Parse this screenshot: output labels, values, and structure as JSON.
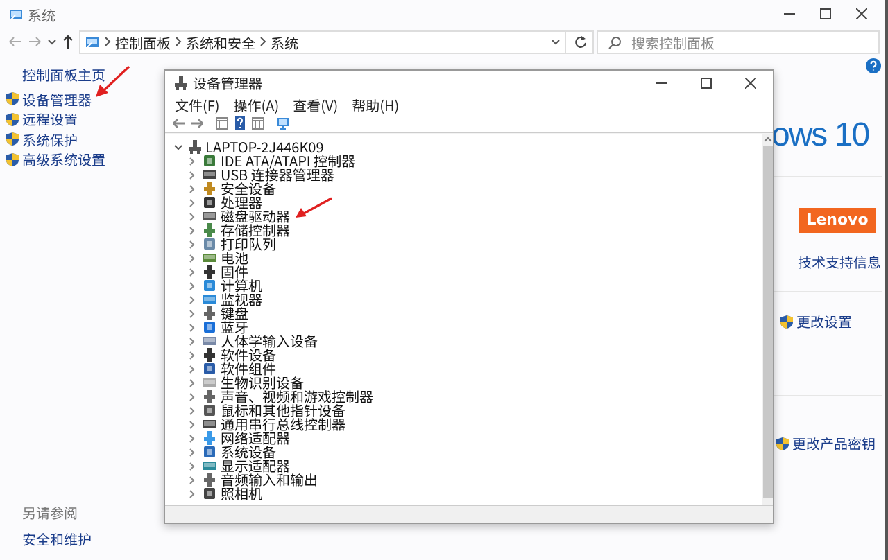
{
  "window": {
    "title": "系统"
  },
  "address": {
    "path": [
      "控制面板",
      "系统和安全",
      "系统"
    ]
  },
  "search": {
    "placeholder": "搜索控制面板"
  },
  "sidebar": {
    "home": "控制面板主页",
    "items": [
      {
        "label": "设备管理器"
      },
      {
        "label": "远程设置"
      },
      {
        "label": "系统保护"
      },
      {
        "label": "高级系统设置"
      }
    ],
    "see_also": "另请参阅",
    "see_also_links": [
      "安全和维护"
    ]
  },
  "device_manager": {
    "title": "设备管理器",
    "menu": [
      "文件(F)",
      "操作(A)",
      "查看(V)",
      "帮助(H)"
    ],
    "tree": {
      "label": "LAPTOP-2J446K09",
      "expanded": true,
      "children": [
        {
          "label": "IDE ATA/ATAPI 控制器",
          "expanded": false
        },
        {
          "label": "USB 连接器管理器",
          "expanded": false
        },
        {
          "label": "安全设备",
          "expanded": false
        },
        {
          "label": "处理器",
          "expanded": false
        },
        {
          "label": "磁盘驱动器",
          "expanded": false
        },
        {
          "label": "存储控制器",
          "expanded": false
        },
        {
          "label": "打印队列",
          "expanded": false
        },
        {
          "label": "电池",
          "expanded": false
        },
        {
          "label": "固件",
          "expanded": false
        },
        {
          "label": "计算机",
          "expanded": false
        },
        {
          "label": "监视器",
          "expanded": false
        },
        {
          "label": "键盘",
          "expanded": false
        },
        {
          "label": "蓝牙",
          "expanded": false
        },
        {
          "label": "人体学输入设备",
          "expanded": false
        },
        {
          "label": "软件设备",
          "expanded": false
        },
        {
          "label": "软件组件",
          "expanded": false
        },
        {
          "label": "生物识别设备",
          "expanded": false
        },
        {
          "label": "声音、视频和游戏控制器",
          "expanded": false
        },
        {
          "label": "鼠标和其他指针设备",
          "expanded": false
        },
        {
          "label": "通用串行总线控制器",
          "expanded": false
        },
        {
          "label": "网络适配器",
          "expanded": false
        },
        {
          "label": "系统设备",
          "expanded": false
        },
        {
          "label": "显示适配器",
          "expanded": false
        },
        {
          "label": "音频输入和输出",
          "expanded": false
        },
        {
          "label": "照相机",
          "expanded": false
        }
      ]
    }
  },
  "right_panel": {
    "windows_text": "ows 10",
    "logo": "Lenovo",
    "support_link": "技术支持信息",
    "change_settings": "更改设置",
    "change_key": "更改产品密钥"
  }
}
